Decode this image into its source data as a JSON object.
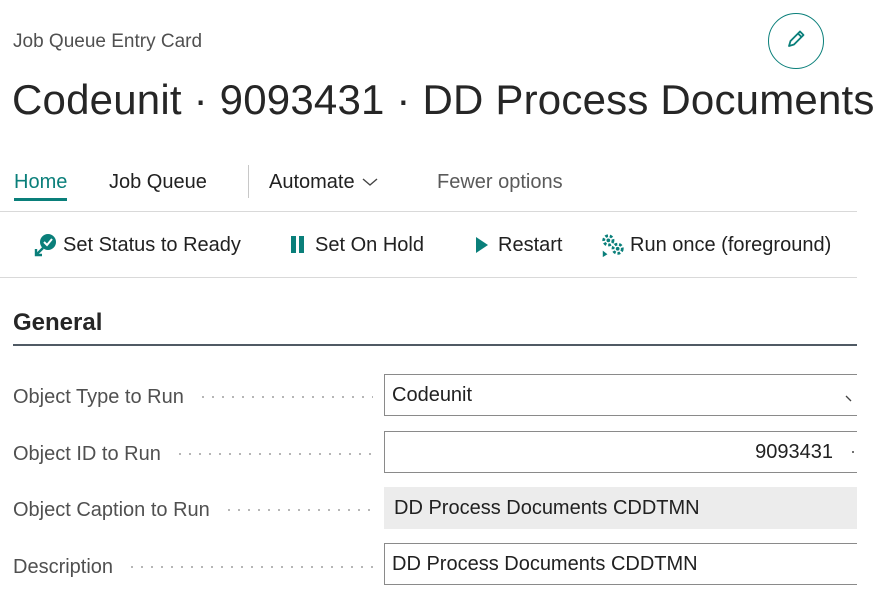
{
  "page": {
    "caption": "Job Queue Entry Card",
    "title": "Codeunit · 9093431 · DD Process Documents"
  },
  "tabs": {
    "home": "Home",
    "job_queue": "Job Queue",
    "automate": "Automate",
    "fewer_options": "Fewer options"
  },
  "actions": {
    "set_status_ready": "Set Status to Ready",
    "set_on_hold": "Set On Hold",
    "restart": "Restart",
    "run_once": "Run once (foreground)"
  },
  "section": {
    "title": "General"
  },
  "fields": {
    "object_type": {
      "label": "Object Type to Run",
      "value": "Codeunit"
    },
    "object_id": {
      "label": "Object ID to Run",
      "value": "9093431"
    },
    "object_caption": {
      "label": "Object Caption to Run",
      "value": "DD Process Documents CDDTMN"
    },
    "description": {
      "label": "Description",
      "value": "DD Process Documents CDDTMN"
    }
  },
  "colors": {
    "accent": "#0a7f7a",
    "text": "#212121",
    "label": "#505050",
    "readonly_bg": "#ececec"
  },
  "icons": {
    "edit": "pencil-icon",
    "set_status_ready": "ready-status-icon",
    "set_on_hold": "pause-icon",
    "restart": "play-icon",
    "run_once": "run-gears-icon",
    "automate": "chevron-down-icon",
    "object_type": "chevron-down-icon"
  }
}
